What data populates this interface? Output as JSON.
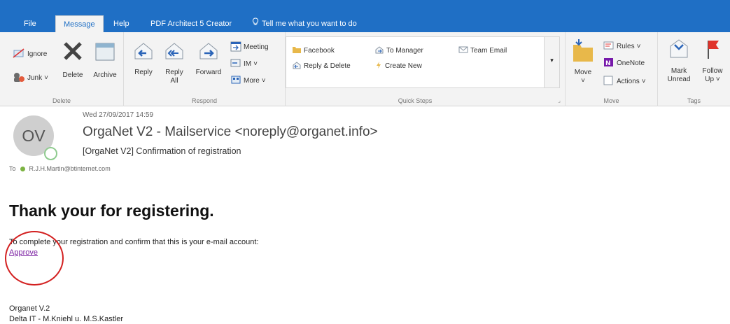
{
  "tabs": [
    {
      "label": "File"
    },
    {
      "label": "Message"
    },
    {
      "label": "Help"
    },
    {
      "label": "PDF Architect 5 Creator"
    },
    {
      "label": "Tell me what you want to do"
    }
  ],
  "ribbon": {
    "delete_group": {
      "label": "Delete",
      "ignore": "Ignore",
      "junk": "Junk",
      "delete": "Delete",
      "archive": "Archive"
    },
    "respond_group": {
      "label": "Respond",
      "reply": "Reply",
      "reply_all_1": "Reply",
      "reply_all_2": "All",
      "forward": "Forward",
      "meeting": "Meeting",
      "im": "IM",
      "more": "More"
    },
    "quick_steps": {
      "label": "Quick Steps",
      "facebook": "Facebook",
      "reply_delete": "Reply & Delete",
      "to_manager": "To Manager",
      "create_new": "Create New",
      "team_email": "Team Email"
    },
    "move_group": {
      "label": "Move",
      "move": "Move",
      "rules": "Rules",
      "onenote": "OneNote",
      "actions": "Actions"
    },
    "tags_group": {
      "label": "Tags",
      "mark_unread_1": "Mark",
      "mark_unread_2": "Unread",
      "follow_up_1": "Follow",
      "follow_up_2": "Up"
    }
  },
  "email": {
    "date": "Wed 27/09/2017 14:59",
    "avatar_initials": "OV",
    "sender": "OrgaNet V2 - Mailservice <noreply@organet.info>",
    "subject": "[OrgaNet V2] Confirmation of registration",
    "to_label": "To",
    "to_address": "R.J.H.Martin@btinternet.com"
  },
  "body": {
    "heading": "Thank your for registering.",
    "instruction": "To complete your registration and confirm that this is your e-mail account:",
    "approve_link": "Approve",
    "signature_line1": "Organet V.2",
    "signature_line2": "Delta IT - M.Kniehl u. M.S.Kastler"
  },
  "colors": {
    "accent": "#1f6fc5",
    "link": "#7b1fa2",
    "highlight_circle": "#d32020"
  }
}
